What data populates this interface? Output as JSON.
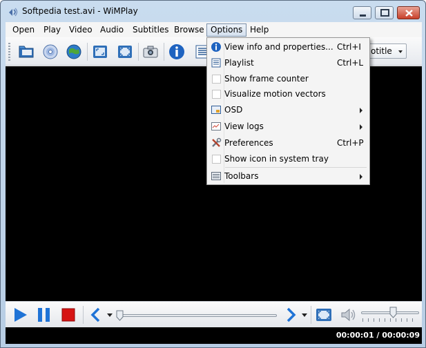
{
  "window": {
    "title": "Softpedia test.avi - WiMPlay"
  },
  "menubar": {
    "items": [
      {
        "label": "Open"
      },
      {
        "label": "Play"
      },
      {
        "label": "Video"
      },
      {
        "label": "Audio"
      },
      {
        "label": "Subtitles"
      },
      {
        "label": "Browse"
      },
      {
        "label": "Options",
        "active": true
      },
      {
        "label": "Help"
      }
    ]
  },
  "toolbar": {
    "buttons": [
      {
        "icon": "open-folder-icon"
      },
      {
        "icon": "open-disc-icon"
      },
      {
        "icon": "open-url-icon"
      },
      {
        "icon": "fit-window-icon"
      },
      {
        "icon": "fullscreen-icon"
      },
      {
        "icon": "snapshot-camera-icon"
      },
      {
        "icon": "info-icon"
      },
      {
        "icon": "playlist-icon"
      }
    ],
    "subtitle_combo": {
      "value": "otitle"
    }
  },
  "options_menu": {
    "items": [
      {
        "label": "View info and properties...",
        "shortcut": "Ctrl+I",
        "icon": "info-icon"
      },
      {
        "label": "Playlist",
        "shortcut": "Ctrl+L",
        "icon": "playlist-icon"
      },
      {
        "label": "Show frame counter",
        "checkbox": true,
        "checked": false
      },
      {
        "label": "Visualize motion vectors",
        "checkbox": true,
        "checked": false
      },
      {
        "label": "OSD",
        "submenu": true,
        "icon": "osd-icon"
      },
      {
        "label": "View logs",
        "submenu": true,
        "icon": "logs-icon"
      },
      {
        "label": "Preferences",
        "shortcut": "Ctrl+P",
        "icon": "preferences-tools-icon"
      },
      {
        "label": "Show icon in system tray",
        "checkbox": true,
        "checked": false
      },
      {
        "label": "Toolbars",
        "submenu": true,
        "icon": "toolbars-icon"
      }
    ]
  },
  "player": {
    "seek_position": 0.0,
    "volume_level": 0.55,
    "time_display": "00:00:01 / 00:00:09"
  },
  "colors": {
    "accent_blue": "#1f73d6",
    "stop_red": "#d61414",
    "video_bg": "#000000"
  }
}
